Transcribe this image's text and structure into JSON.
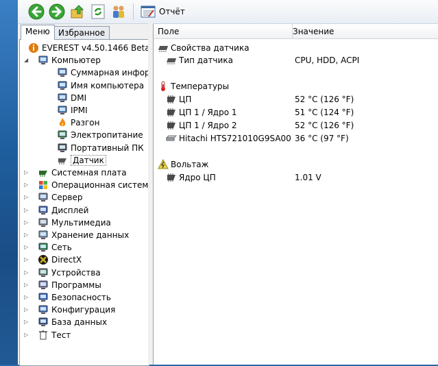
{
  "toolbar": {
    "buttons": [
      "back-icon",
      "forward-icon",
      "up-icon",
      "refresh-icon",
      "users-icon"
    ],
    "report_label": "Отчёт"
  },
  "left": {
    "tabs": [
      "Меню",
      "Избранное"
    ],
    "tree": [
      {
        "label": "EVEREST v4.50.1466 Beta",
        "icon": "info-icon"
      },
      {
        "label": "Компьютер",
        "icon": "computer-icon"
      },
      {
        "label": "Суммарная информа",
        "icon": "summary-icon"
      },
      {
        "label": "Имя компьютера",
        "icon": "computer-name-icon"
      },
      {
        "label": "DMI",
        "icon": "dmi-icon"
      },
      {
        "label": "IPMI",
        "icon": "ipmi-icon"
      },
      {
        "label": "Разгон",
        "icon": "flame-icon"
      },
      {
        "label": "Электропитание",
        "icon": "power-icon"
      },
      {
        "label": "Портативный ПК",
        "icon": "laptop-icon"
      },
      {
        "label": "Датчик",
        "icon": "sensor-icon"
      },
      {
        "label": "Системная плата",
        "icon": "motherboard-icon"
      },
      {
        "label": "Операционная система",
        "icon": "windows-icon"
      },
      {
        "label": "Сервер",
        "icon": "server-icon"
      },
      {
        "label": "Дисплей",
        "icon": "display-icon"
      },
      {
        "label": "Мультимедиа",
        "icon": "multimedia-icon"
      },
      {
        "label": "Хранение данных",
        "icon": "storage-icon"
      },
      {
        "label": "Сеть",
        "icon": "network-icon"
      },
      {
        "label": "DirectX",
        "icon": "directx-icon"
      },
      {
        "label": "Устройства",
        "icon": "devices-icon"
      },
      {
        "label": "Программы",
        "icon": "programs-icon"
      },
      {
        "label": "Безопасность",
        "icon": "security-icon"
      },
      {
        "label": "Конфигурация",
        "icon": "config-icon"
      },
      {
        "label": "База данных",
        "icon": "database-icon"
      },
      {
        "label": "Тест",
        "icon": "test-icon"
      }
    ]
  },
  "right": {
    "headers": [
      "Поле",
      "Значение"
    ],
    "sections": {
      "sensor_props": "Свойства датчика",
      "sensor_type": {
        "field": "Тип датчика",
        "value": "CPU, HDD, ACPI"
      },
      "temps": "Температуры",
      "temp_rows": [
        {
          "field": "ЦП",
          "value": "52 °C  (126 °F)"
        },
        {
          "field": "ЦП 1 / Ядро 1",
          "value": "51 °C  (124 °F)"
        },
        {
          "field": "ЦП 1 / Ядро 2",
          "value": "52 °C  (126 °F)"
        },
        {
          "field": "Hitachi HTS721010G9SA00",
          "value": "36 °C  (97 °F)"
        }
      ],
      "voltage": "Вольтаж",
      "volt_rows": [
        {
          "field": "Ядро ЦП",
          "value": "1.01 V"
        }
      ]
    }
  },
  "colors": {
    "desktop": "#2a6aa8",
    "window_bg": "#f0f0f0",
    "header_border": "#d5d5d5"
  }
}
